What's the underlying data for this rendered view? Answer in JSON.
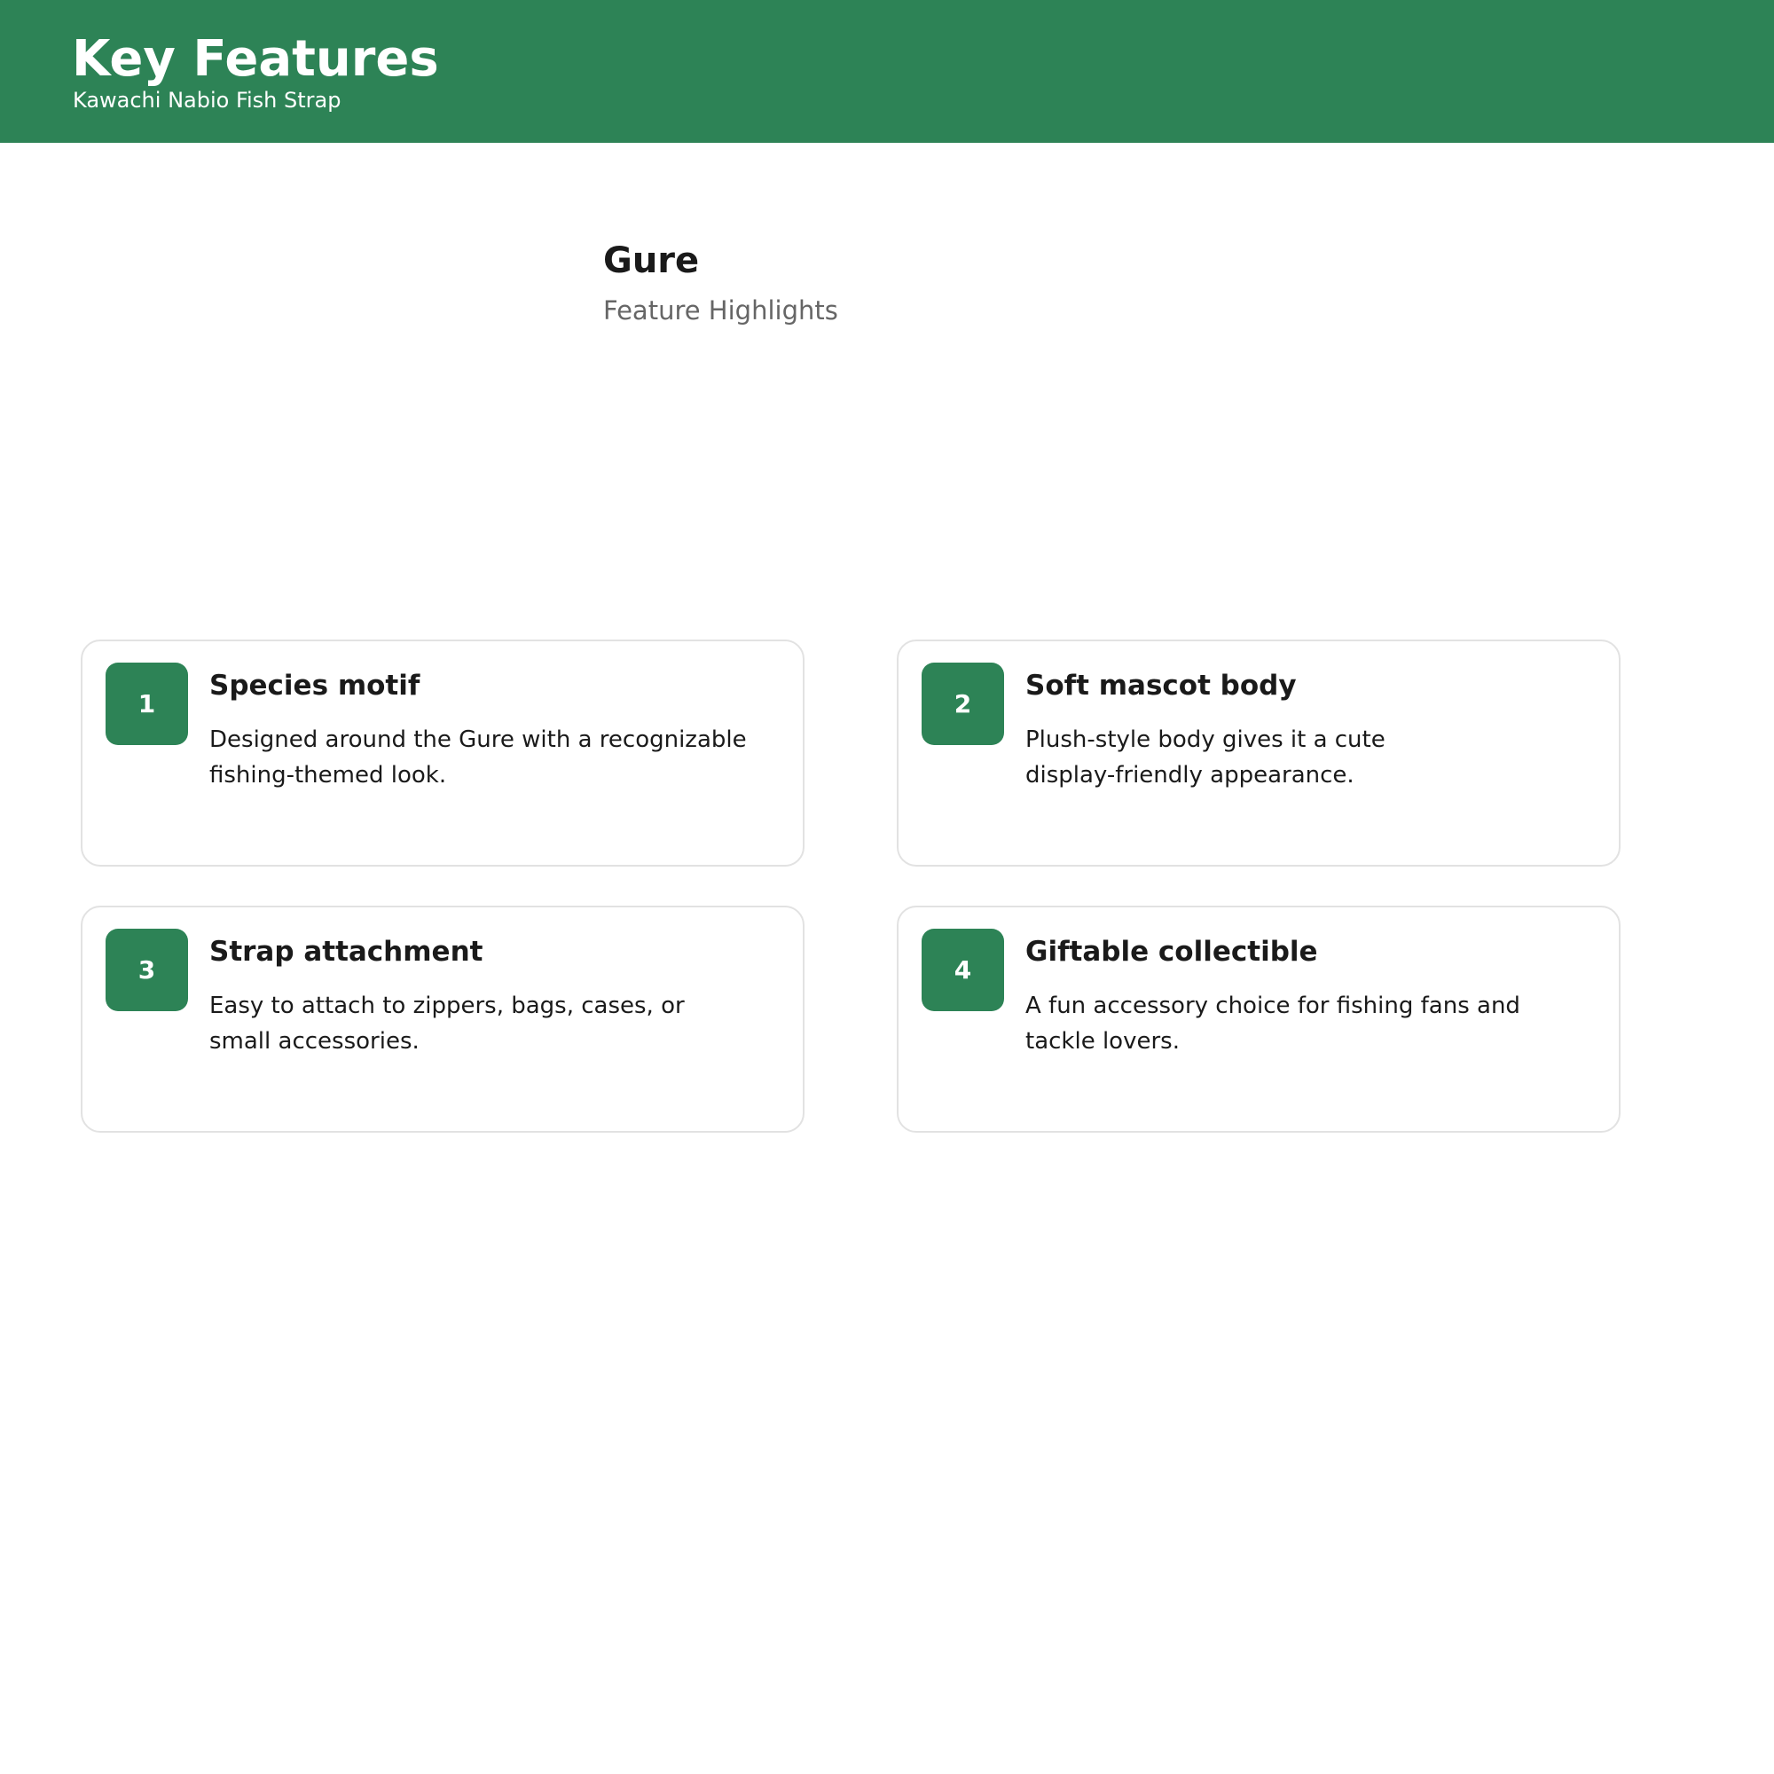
{
  "header": {
    "title": "Key Features",
    "subtitle": "Kawachi Nabio Fish Strap"
  },
  "product": {
    "name": "Gure",
    "section_label": "Feature Highlights"
  },
  "features": [
    {
      "number": "1",
      "title": "Species motif",
      "description": "Designed around the Gure with a recognizable fishing-themed look."
    },
    {
      "number": "2",
      "title": "Soft mascot body",
      "description": "Plush-style body gives it a cute display-friendly appearance."
    },
    {
      "number": "3",
      "title": "Strap attachment",
      "description": "Easy to attach to zippers, bags, cases, or small accessories."
    },
    {
      "number": "4",
      "title": "Giftable collectible",
      "description": "A fun accessory choice for fishing fans and tackle lovers."
    }
  ],
  "colors": {
    "brand_green": "#2d8356",
    "card_border": "#e2e2e2",
    "muted_text": "#666666"
  }
}
